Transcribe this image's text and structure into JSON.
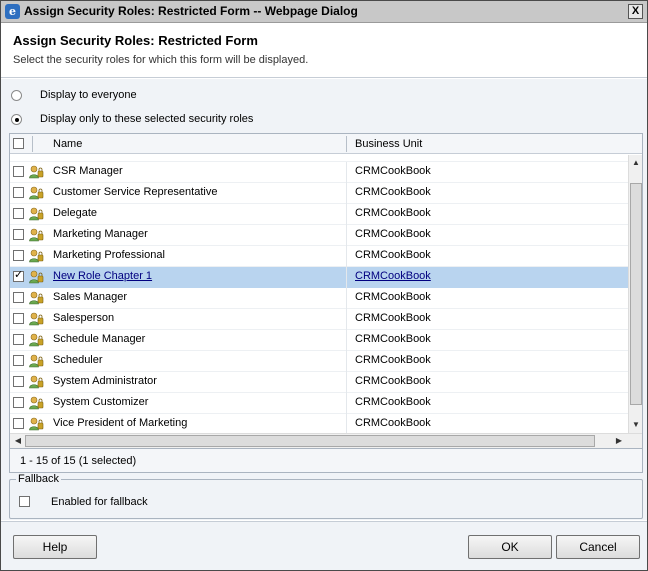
{
  "window": {
    "title": "Assign Security Roles: Restricted Form -- Webpage Dialog",
    "app_icon": "ie-icon",
    "app_icon_glyph": "e",
    "close_glyph": "X"
  },
  "header": {
    "title": "Assign Security Roles: Restricted Form",
    "subtitle": "Select the security roles for which this form will be displayed."
  },
  "visibility": {
    "options": [
      {
        "label": "Display to everyone",
        "selected": false
      },
      {
        "label": "Display only to these selected security roles",
        "selected": true
      }
    ]
  },
  "grid": {
    "columns": {
      "name": "Name",
      "business_unit": "Business Unit"
    },
    "rows": [
      {
        "name": "CSR Manager",
        "business_unit": "CRMCookBook",
        "checked": false
      },
      {
        "name": "Customer Service Representative",
        "business_unit": "CRMCookBook",
        "checked": false
      },
      {
        "name": "Delegate",
        "business_unit": "CRMCookBook",
        "checked": false
      },
      {
        "name": "Marketing Manager",
        "business_unit": "CRMCookBook",
        "checked": false
      },
      {
        "name": "Marketing Professional",
        "business_unit": "CRMCookBook",
        "checked": false
      },
      {
        "name": "New Role Chapter 1",
        "business_unit": "CRMCookBook",
        "checked": true
      },
      {
        "name": "Sales Manager",
        "business_unit": "CRMCookBook",
        "checked": false
      },
      {
        "name": "Salesperson",
        "business_unit": "CRMCookBook",
        "checked": false
      },
      {
        "name": "Schedule Manager",
        "business_unit": "CRMCookBook",
        "checked": false
      },
      {
        "name": "Scheduler",
        "business_unit": "CRMCookBook",
        "checked": false
      },
      {
        "name": "System Administrator",
        "business_unit": "CRMCookBook",
        "checked": false
      },
      {
        "name": "System Customizer",
        "business_unit": "CRMCookBook",
        "checked": false
      },
      {
        "name": "Vice President of Marketing",
        "business_unit": "CRMCookBook",
        "checked": false
      }
    ],
    "row_icon": "security-role-icon",
    "selected_row_color": "#b9d4ef",
    "status": "1 - 15 of 15 (1 selected)"
  },
  "fallback": {
    "legend": "Fallback",
    "checkbox_label": "Enabled for fallback",
    "checked": false
  },
  "buttons": {
    "help": "Help",
    "ok": "OK",
    "cancel": "Cancel"
  }
}
